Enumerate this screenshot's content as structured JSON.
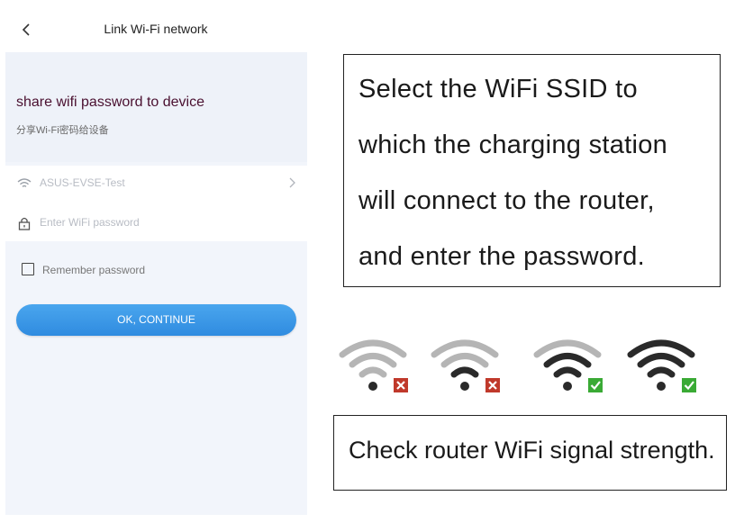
{
  "topbar": {
    "title": "Link Wi-Fi network"
  },
  "header": {
    "title": "share wifi password to device",
    "subtitle": "分享Wi-Fi密码给设备"
  },
  "form": {
    "ssid_value": "ASUS-EVSE-Test",
    "password_placeholder": "Enter WiFi password",
    "remember_label": "Remember password",
    "remember_checked": false,
    "ok_button": "OK, CONTINUE"
  },
  "colors": {
    "accent": "#3896e8",
    "fail": "#c0392b",
    "pass": "#3aaa35"
  },
  "annotation": {
    "lines": [
      "Select the WiFi SSID to",
      "which the charging station",
      "will connect to the router,",
      "and enter the password."
    ],
    "signal_caption": "Check router WiFi signal strength."
  },
  "signal_examples": [
    {
      "bars": 1,
      "status": "fail"
    },
    {
      "bars": 2,
      "status": "fail"
    },
    {
      "bars": 3,
      "status": "pass"
    },
    {
      "bars": 4,
      "status": "pass"
    }
  ]
}
